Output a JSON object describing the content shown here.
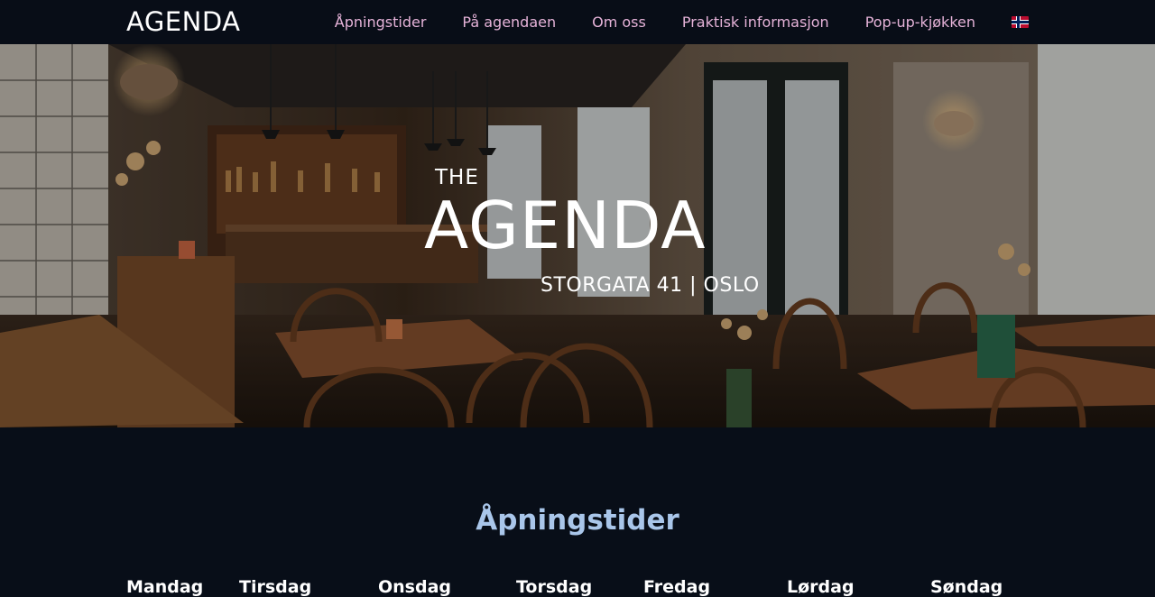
{
  "nav": {
    "brand": "AGENDA",
    "links": [
      "Åpningstider",
      "På agendaen",
      "Om oss",
      "Praktisk informasjon",
      "Pop-up-kjøkken"
    ],
    "language_flag": "norway-flag-icon",
    "link_color": "#e6b3d9"
  },
  "hero": {
    "the": "THE",
    "title": "AGENDA",
    "address": "STORGATA 41 | OSLO"
  },
  "hours": {
    "title": "Åpningstider",
    "title_color": "#a9c6ea",
    "days": [
      "Mandag",
      "Tirsdag",
      "Onsdag",
      "Torsdag",
      "Fredag",
      "Lørdag",
      "Søndag"
    ]
  }
}
